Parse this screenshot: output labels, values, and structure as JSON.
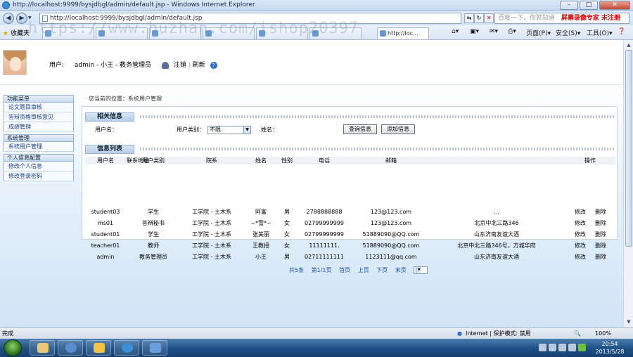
{
  "browser": {
    "title": "http://localhost:9999/bysjdbgl/admin/default.jsp - Windows Internet Explorer",
    "address": "http://localhost:9999/bysjdbgl/admin/default.jsp",
    "search_placeholder": "百度一下，你就知道",
    "search_ad": "屏幕录像专家 未注册",
    "favorites_label": "收藏夹",
    "tabs": [
      "http://loc..."
    ],
    "commands": [
      "页面(P)",
      "安全(S)",
      "工具(O)"
    ],
    "watermark": "https://www.huzhan.com/ishop20397"
  },
  "header": {
    "user_label": "用户:",
    "user_value": "admin - 小王 - 教务管理员",
    "logout": "注销",
    "refresh": "刷新"
  },
  "sidebar": {
    "sections": [
      {
        "title": "功能菜单",
        "items": [
          "论文题目审核",
          "答辩资格审核意见",
          "成绩管理"
        ]
      },
      {
        "title": "系统管理",
        "items": [
          "系统用户管理"
        ]
      },
      {
        "title": "个人信息配置",
        "items": [
          "修改个人信息",
          "修改登录密码"
        ]
      }
    ]
  },
  "main": {
    "breadcrumb": "您当前的位置：系统用户管理",
    "info_title": "相关信息",
    "search": {
      "username_label": "用户名：",
      "usertype_label": "用户类别：",
      "usertype_value": "不限",
      "name_label": "姓名：",
      "query_button": "查询信息",
      "add_button": "添加信息"
    },
    "list_title": "信息列表",
    "columns": [
      "用户名",
      "用户类别",
      "院系",
      "姓名",
      "性别",
      "电话",
      "邮箱",
      "联系地址",
      "操作"
    ],
    "rows": [
      [
        "student03",
        "学生",
        "工学院 - 土木系",
        "阿富",
        "男",
        "2788888888",
        "123@123.com",
        "…"
      ],
      [
        "ms01",
        "答辩秘书",
        "工学院 - 土木系",
        "~*雪*~",
        "女",
        "02799999999",
        "123@123.com",
        "北京中北三路346"
      ],
      [
        "student01",
        "学生",
        "工学院 - 土木系",
        "张美丽",
        "女",
        "02799999999",
        "51889090@QQ.com",
        "山东济南友谊大酒"
      ],
      [
        "teacher01",
        "教师",
        "工学院 - 土木系",
        "王教授",
        "女",
        "11111111.",
        "51889090@QQ.com",
        "北京中北三路346号，万城华府"
      ],
      [
        "admin",
        "教务管理员",
        "工学院 - 土木系",
        "小王",
        "男",
        "02711111111",
        "1123111@qq.com",
        "山东济南友谊大酒"
      ]
    ],
    "actions": {
      "edit": "修改",
      "delete": "删除"
    },
    "pager": {
      "total": "共5条",
      "pages": "第1/1页",
      "first": "首页",
      "prev": "上页",
      "next": "下页",
      "last": "末页",
      "current": "1"
    }
  },
  "status": {
    "left": "完成",
    "zone": "Internet | 保护模式: 禁用",
    "zoom": "100%"
  },
  "taskbar": {
    "time": "20:54",
    "date": "2013/5/28"
  }
}
